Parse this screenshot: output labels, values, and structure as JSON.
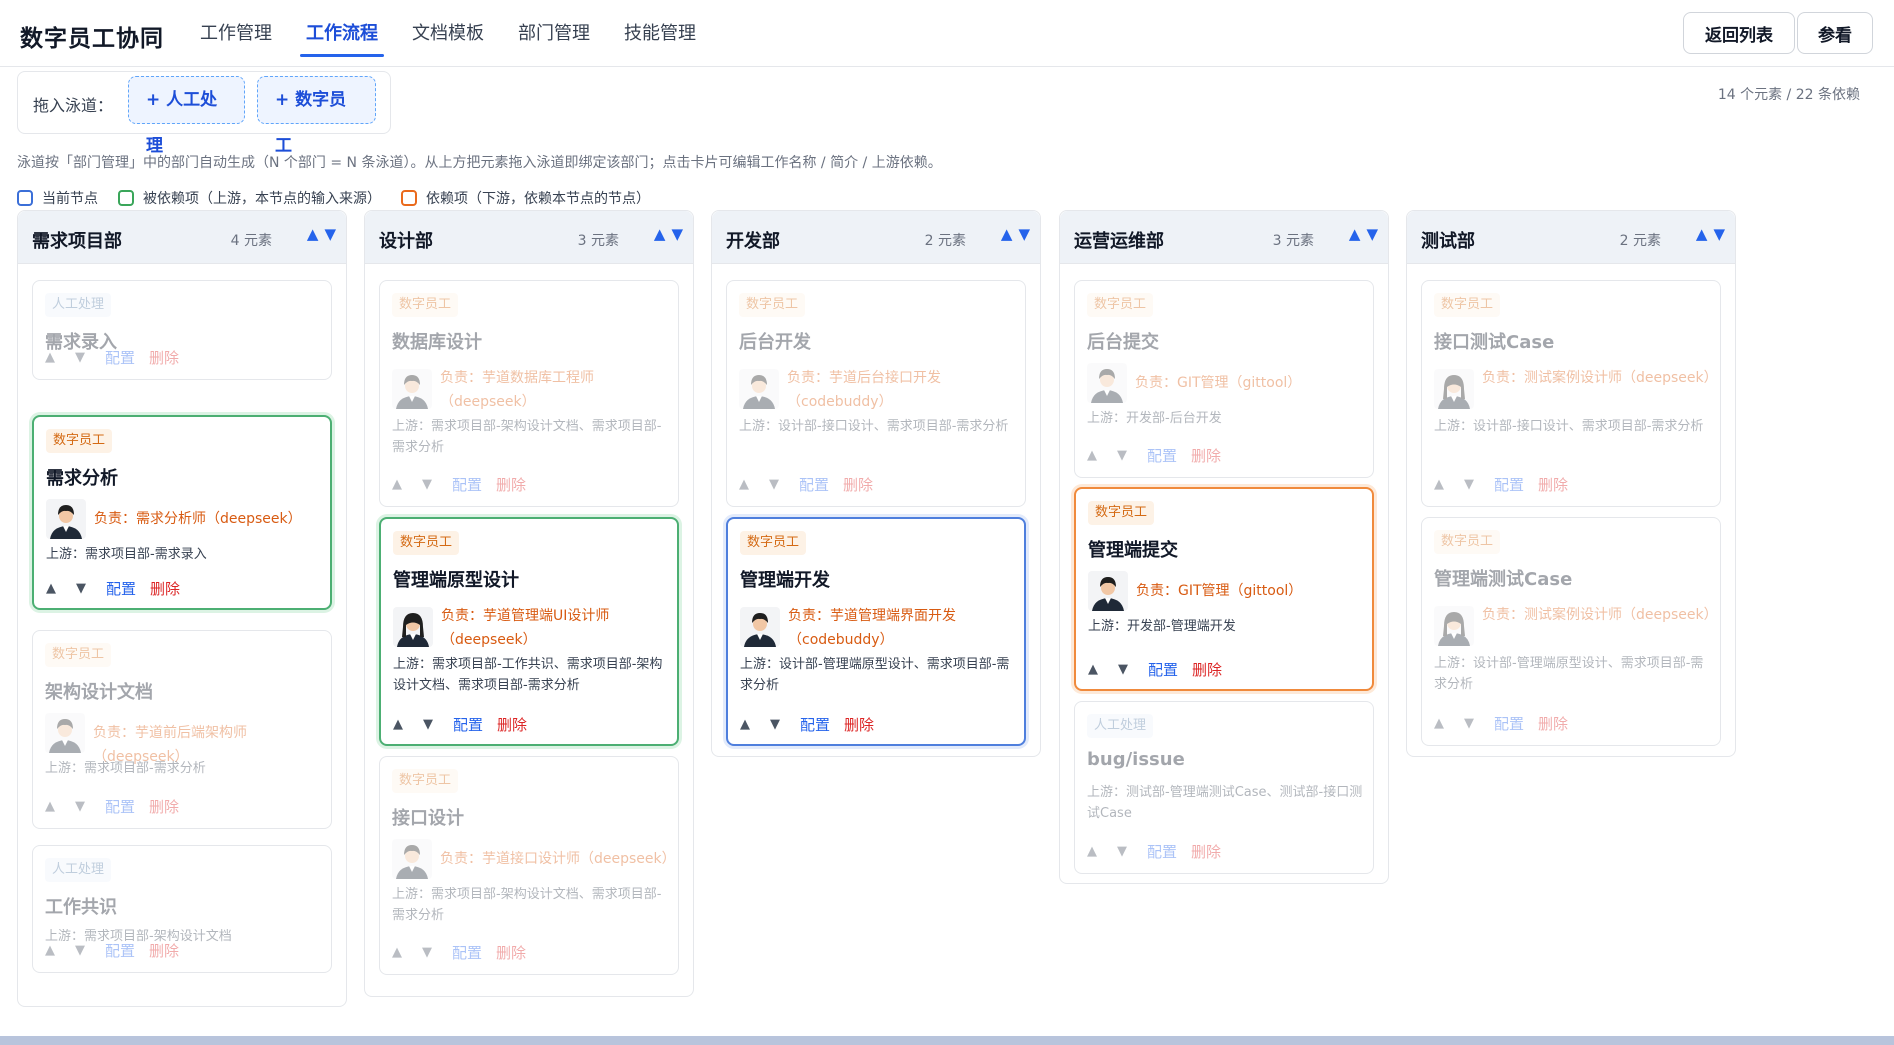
{
  "app": {
    "title": "数字员工协同"
  },
  "nav": [
    {
      "label": "工作管理",
      "active": false
    },
    {
      "label": "工作流程",
      "active": true
    },
    {
      "label": "文档模板",
      "active": false
    },
    {
      "label": "部门管理",
      "active": false
    },
    {
      "label": "技能管理",
      "active": false
    }
  ],
  "toolbar": {
    "back_label": "返回列表",
    "view_label": "参看"
  },
  "palette": {
    "label": "拖入泳道：",
    "human_chip": "+ 人工处理",
    "digital_chip": "+ 数字员工"
  },
  "stats": "14 个元素 / 22 条依赖",
  "hint": "泳道按「部门管理」中的部门自动生成（N 个部门 = N 条泳道）。从上方把元素拖入泳道即绑定该部门；点击卡片可编辑工作名称 / 简介 / 上游依赖。",
  "legend": [
    {
      "label": "当前节点",
      "color": "#3b6fd8"
    },
    {
      "label": "被依赖项（上游，本节点的输入来源）",
      "color": "#3aa65a"
    },
    {
      "label": "依赖项（下游，依赖本节点的节点）",
      "color": "#ea6a1c"
    }
  ],
  "colors": {
    "accent": "#2563eb",
    "current": "#3b6fd8",
    "upstream": "#3aa65a",
    "downstream": "#ea6a1c",
    "delete": "#dc2626"
  },
  "common": {
    "config_label": "配置",
    "delete_label": "删除",
    "up_icon": "▲",
    "down_icon": "▼"
  },
  "lanes": [
    {
      "name": "需求项目部",
      "count": "4 元素",
      "cards": [
        {
          "tag": "人工处理",
          "title": "需求录入",
          "state": "dim"
        },
        {
          "tag": "数字员工",
          "title": "需求分析",
          "owner": "负责：需求分析师（deepseek）",
          "upstream": "上游：需求项目部-需求录入",
          "state": "upstream"
        },
        {
          "tag": "数字员工",
          "title": "架构设计文档",
          "owner": "负责：芋道前后端架构师（deepseek）",
          "upstream": "上游：需求项目部-需求分析",
          "state": "dim"
        },
        {
          "tag": "人工处理",
          "title": "工作共识",
          "upstream": "上游：需求项目部-架构设计文档",
          "state": "dim"
        }
      ]
    },
    {
      "name": "设计部",
      "count": "3 元素",
      "cards": [
        {
          "tag": "数字员工",
          "title": "数据库设计",
          "owner": "负责：芋道数据库工程师（deepseek）",
          "upstream": "上游：需求项目部-架构设计文档、需求项目部-需求分析",
          "state": "dim"
        },
        {
          "tag": "数字员工",
          "title": "管理端原型设计",
          "owner": "负责：芋道管理端UI设计师（deepseek）",
          "upstream": "上游：需求项目部-工作共识、需求项目部-架构设计文档、需求项目部-需求分析",
          "state": "upstream"
        },
        {
          "tag": "数字员工",
          "title": "接口设计",
          "owner": "负责：芋道接口设计师（deepseek）",
          "upstream": "上游：需求项目部-架构设计文档、需求项目部-需求分析",
          "state": "dim"
        }
      ]
    },
    {
      "name": "开发部",
      "count": "2 元素",
      "cards": [
        {
          "tag": "数字员工",
          "title": "后台开发",
          "owner": "负责：芋道后台接口开发（codebuddy）",
          "upstream": "上游：设计部-接口设计、需求项目部-需求分析",
          "state": "dim"
        },
        {
          "tag": "数字员工",
          "title": "管理端开发",
          "owner": "负责：芋道管理端界面开发（codebuddy）",
          "upstream": "上游：设计部-管理端原型设计、需求项目部-需求分析",
          "state": "current"
        }
      ]
    },
    {
      "name": "运营运维部",
      "count": "3 元素",
      "cards": [
        {
          "tag": "数字员工",
          "title": "后台提交",
          "owner": "负责：GIT管理（gittool）",
          "upstream": "上游：开发部-后台开发",
          "state": "dim"
        },
        {
          "tag": "数字员工",
          "title": "管理端提交",
          "owner": "负责：GIT管理（gittool）",
          "upstream": "上游：开发部-管理端开发",
          "state": "downstream"
        },
        {
          "tag": "人工处理",
          "title": "bug/issue",
          "upstream": "上游：测试部-管理端测试Case、测试部-接口测试Case",
          "state": "dim"
        }
      ]
    },
    {
      "name": "测试部",
      "count": "2 元素",
      "cards": [
        {
          "tag": "数字员工",
          "title": "接口测试Case",
          "owner": "负责：测试案例设计师（deepseek）",
          "upstream": "上游：设计部-接口设计、需求项目部-需求分析",
          "state": "dim"
        },
        {
          "tag": "数字员工",
          "title": "管理端测试Case",
          "owner": "负责：测试案例设计师（deepseek）",
          "upstream": "上游：设计部-管理端原型设计、需求项目部-需求分析",
          "state": "dim"
        }
      ]
    }
  ]
}
